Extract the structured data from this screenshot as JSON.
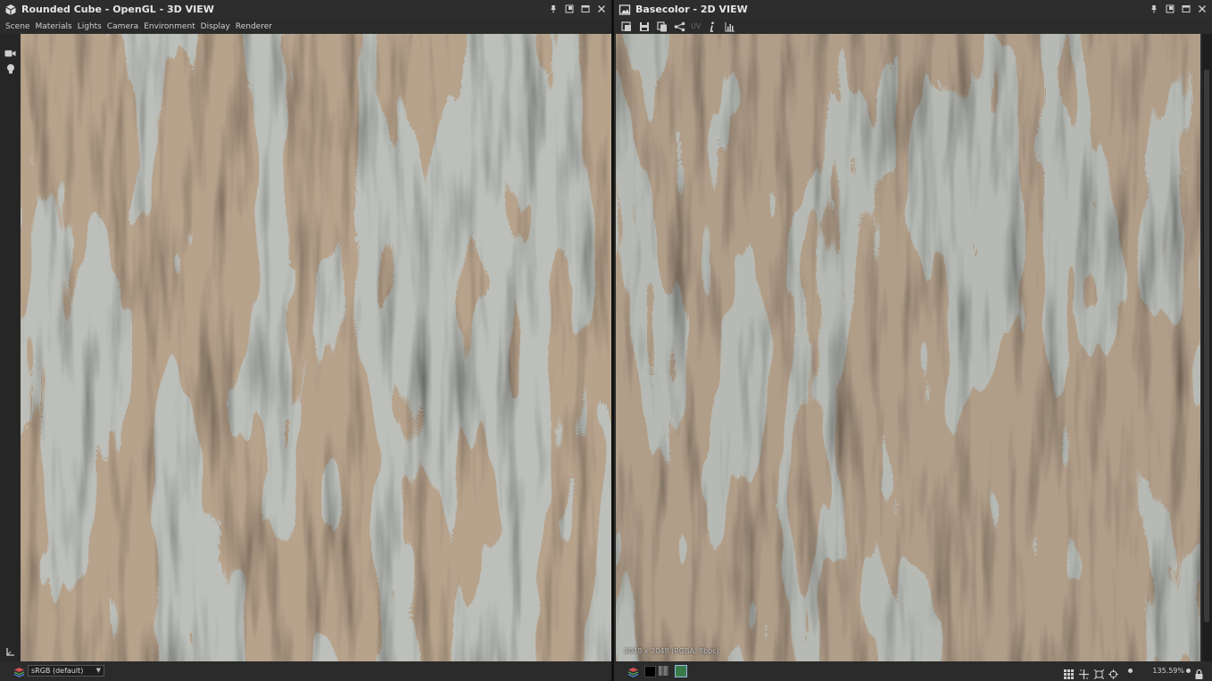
{
  "left_panel": {
    "title": "Rounded Cube - OpenGL - 3D VIEW",
    "menu": [
      "Scene",
      "Materials",
      "Lights",
      "Camera",
      "Environment",
      "Display",
      "Renderer"
    ],
    "colorspace": "sRGB (default)"
  },
  "right_panel": {
    "title": "Basecolor - 2D VIEW",
    "uv_label": "UV",
    "image_info": "2048 x 2048 (RGBA, 8bpc)",
    "zoom": "135.59%"
  },
  "icons": {
    "cube": "cube-icon",
    "image": "image-icon",
    "pin": "pin-icon",
    "float": "float-window-icon",
    "maximize": "maximize-icon",
    "close": "close-icon",
    "camera": "camera-icon",
    "light": "light-bulb-icon",
    "layers": "layers-icon",
    "histogram": "histogram-icon",
    "info": "info-icon"
  },
  "colors": {
    "panel_bg": "#2b2b2b",
    "wood": "#7c5e44",
    "bark": "#7f8479"
  }
}
